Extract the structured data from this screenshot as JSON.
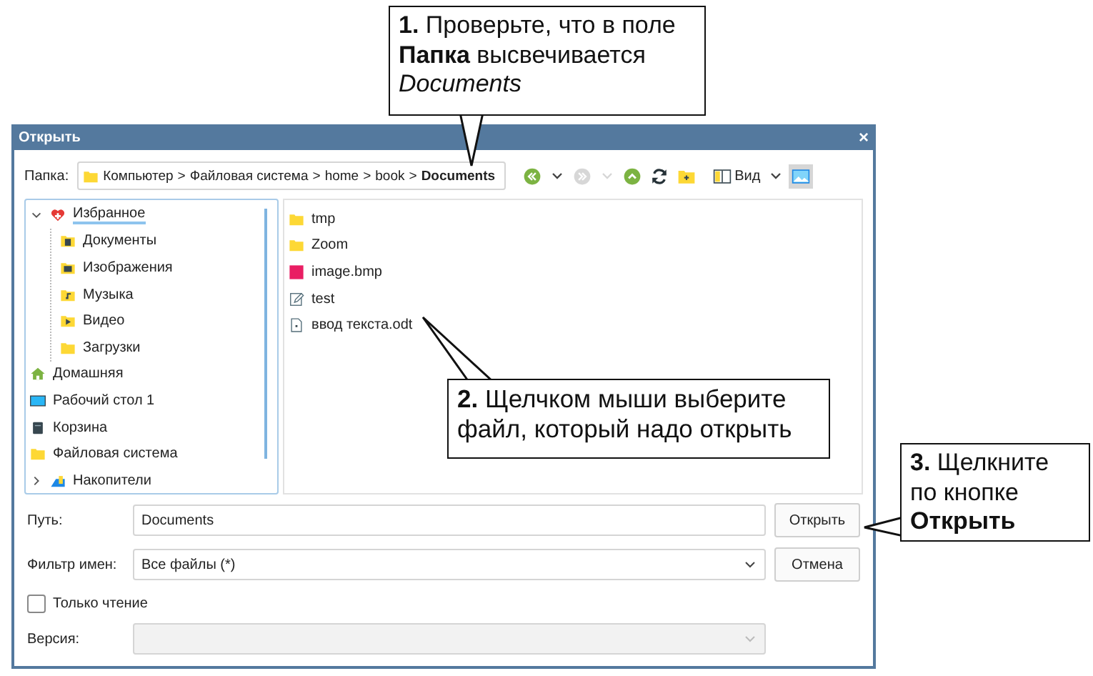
{
  "window": {
    "title": "Открыть",
    "close": "×"
  },
  "folder_bar": {
    "label": "Папка:",
    "separator": ">",
    "segments": [
      {
        "text": "Компьютер",
        "current": false
      },
      {
        "text": "Файловая система",
        "current": false
      },
      {
        "text": "home",
        "current": false
      },
      {
        "text": "book",
        "current": false
      },
      {
        "text": "Documents",
        "current": true
      }
    ]
  },
  "toolbar": [
    {
      "kind": "back",
      "disabled": false
    },
    {
      "kind": "dropdown",
      "disabled": false
    },
    {
      "kind": "forward",
      "disabled": true
    },
    {
      "kind": "dropdown",
      "disabled": true
    },
    {
      "kind": "up",
      "disabled": false
    },
    {
      "kind": "reload",
      "disabled": false
    },
    {
      "kind": "newfolder",
      "disabled": false
    },
    {
      "kind": "view",
      "label": "Вид",
      "disabled": false
    },
    {
      "kind": "dropdown",
      "disabled": false
    },
    {
      "kind": "preview",
      "disabled": false,
      "selected": true
    }
  ],
  "places": [
    {
      "label": "Избранное",
      "kind": "favorites",
      "selected": true,
      "expanded": true,
      "children": [
        {
          "label": "Документы",
          "kind": "documents",
          "selected": false
        },
        {
          "label": "Изображения",
          "kind": "pictures",
          "selected": false
        },
        {
          "label": "Музыка",
          "kind": "music",
          "selected": false
        },
        {
          "label": "Видео",
          "kind": "video",
          "selected": false
        },
        {
          "label": "Загрузки",
          "kind": "folder",
          "selected": false
        }
      ]
    },
    {
      "label": "Домашняя",
      "kind": "home",
      "selected": false
    },
    {
      "label": "Рабочий стол 1",
      "kind": "desktop",
      "selected": false
    },
    {
      "label": "Корзина",
      "kind": "trash",
      "selected": false
    },
    {
      "label": "Файловая система",
      "kind": "folder",
      "selected": false
    },
    {
      "label": "Накопители",
      "kind": "drives",
      "selected": false,
      "expanded": false
    }
  ],
  "files": [
    {
      "name": "tmp",
      "kind": "folder"
    },
    {
      "name": "Zoom",
      "kind": "folder"
    },
    {
      "name": "image.bmp",
      "kind": "image"
    },
    {
      "name": "test",
      "kind": "text"
    },
    {
      "name": "ввод текста.odt",
      "kind": "document"
    }
  ],
  "form": {
    "path_label": "Путь:",
    "path_value": "Documents",
    "filter_label": "Фильтр имен:",
    "filter_value": "Все файлы (*)",
    "readonly_label": "Только чтение",
    "readonly_checked": false,
    "version_label": "Версия:",
    "version_disabled": true,
    "open_button": "Открыть",
    "cancel_button": "Отмена"
  },
  "callouts": [
    {
      "lines": [
        "**1.** Проверьте, что в поле",
        "**Папка** высвечивается",
        "*Documents*"
      ]
    },
    {
      "lines": [
        "**2.** Щелчком мыши выберите",
        "файл, который надо открыть"
      ]
    },
    {
      "lines": [
        "**3.** Щелкните",
        "по кнопке",
        "**Открыть**"
      ]
    }
  ]
}
